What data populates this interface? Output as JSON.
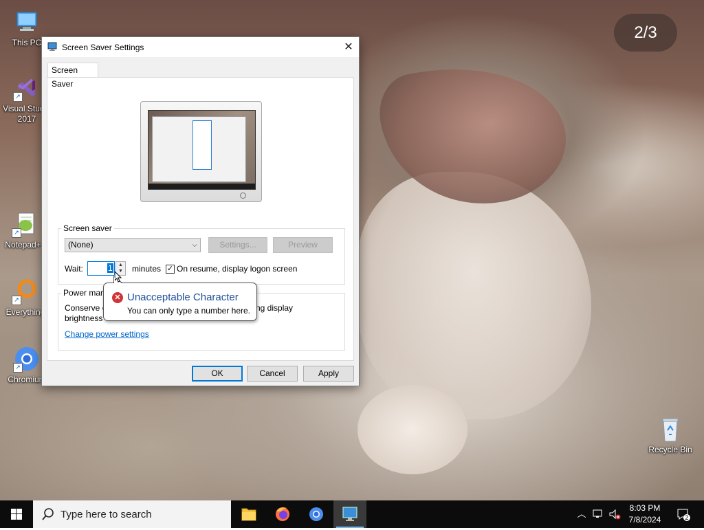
{
  "desktop": {
    "photo_counter": "2/3",
    "icons": [
      {
        "label": "This PC"
      },
      {
        "label": "Visual Studio 2017"
      },
      {
        "label": "Notepad++"
      },
      {
        "label": "Everything"
      },
      {
        "label": "Chromium"
      },
      {
        "label": "Recycle Bin"
      }
    ]
  },
  "dialog": {
    "title": "Screen Saver Settings",
    "tab": "Screen Saver",
    "screen_saver_group": {
      "label": "Screen saver",
      "selected": "(None)",
      "settings_button": "Settings...",
      "preview_button": "Preview",
      "wait_label": "Wait:",
      "wait_value": "1",
      "minutes_label": "minutes",
      "resume_checkbox_label": "On resume, display logon screen",
      "resume_checked": true
    },
    "power_group": {
      "label": "Power man",
      "text_line1": "Conserve e",
      "text_line1_end": "ng display",
      "text_line2": "brightness",
      "link": "Change power settings"
    },
    "buttons": {
      "ok": "OK",
      "cancel": "Cancel",
      "apply": "Apply"
    }
  },
  "balloon": {
    "title": "Unacceptable Character",
    "message": "You can only type a number here."
  },
  "taskbar": {
    "search_placeholder": "Type here to search",
    "time": "8:03 PM",
    "date": "7/8/2024",
    "notification_count": "2"
  },
  "colors": {
    "accent": "#0078d7",
    "error": "#d13438",
    "link": "#0066cc",
    "balloon_title": "#1e4f9c"
  }
}
